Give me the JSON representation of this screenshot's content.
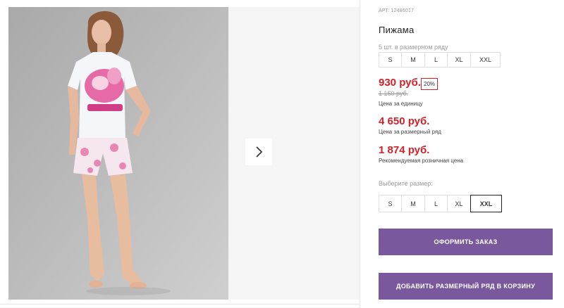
{
  "product": {
    "article": "АРТ. 12486017",
    "title": "Пижама",
    "pack_label": "5 шт. в размерном ряду",
    "pack_sizes": [
      "S",
      "M",
      "L",
      "XL",
      "XXL"
    ],
    "price": "930 руб.",
    "discount": "20%",
    "old_price": "1 160 руб.",
    "price_note": "Цена за единицу",
    "pack_price": "4 650 руб.",
    "pack_price_note": "Цена за размерный ряд",
    "retail_price": "1 874 руб.",
    "retail_price_note": "Рекомендуемая розничная цена",
    "choose_label": "Выберите размер:",
    "size_options": [
      "S",
      "M",
      "L",
      "XL",
      "XXL"
    ],
    "selected_size": "XXL"
  },
  "actions": {
    "order_label": "ОФОРМИТЬ ЗАКАЗ",
    "add_pack_label": "ДОБАВИТЬ РАЗМЕРНЫЙ РЯД В КОРЗИНУ"
  },
  "gallery": {
    "next_icon": "chevron-right-icon"
  },
  "colors": {
    "price": "#d81f26",
    "button": "#7a589e",
    "photo_bg": "#b9b9b9"
  }
}
